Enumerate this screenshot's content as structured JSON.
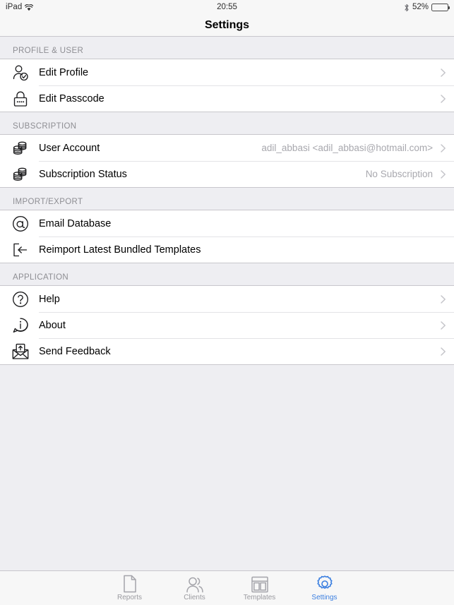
{
  "statusbar": {
    "device": "iPad",
    "wifi_icon": "wifi-icon",
    "time": "20:55",
    "bluetooth_icon": "bluetooth-icon",
    "battery_percent": "52%",
    "battery_level": 52
  },
  "navbar": {
    "title": "Settings"
  },
  "colors": {
    "accent": "#3b7fe0",
    "background": "#eeeef2",
    "row_background": "#ffffff",
    "separator": "#c8c7cc",
    "secondary_text": "#8e8e93",
    "value_text": "#a8a8ae"
  },
  "sections": [
    {
      "header": "PROFILE & USER",
      "rows": [
        {
          "label": "Edit Profile",
          "icon": "user-check-icon",
          "value": "",
          "chevron": true
        },
        {
          "label": "Edit Passcode",
          "icon": "padlock-icon",
          "value": "",
          "chevron": true
        }
      ]
    },
    {
      "header": "SUBSCRIPTION",
      "rows": [
        {
          "label": "User Account",
          "icon": "coin-stack-icon",
          "value": "adil_abbasi <adil_abbasi@hotmail.com>",
          "chevron": true
        },
        {
          "label": "Subscription Status",
          "icon": "coin-stack-icon",
          "value": "No Subscription",
          "chevron": true
        }
      ]
    },
    {
      "header": "IMPORT/EXPORT",
      "rows": [
        {
          "label": "Email Database",
          "icon": "at-sign-icon",
          "value": "",
          "chevron": false
        },
        {
          "label": "Reimport Latest Bundled Templates",
          "icon": "import-arrow-icon",
          "value": "",
          "chevron": false
        }
      ]
    },
    {
      "header": "APPLICATION",
      "rows": [
        {
          "label": "Help",
          "icon": "question-circle-icon",
          "value": "",
          "chevron": true
        },
        {
          "label": "About",
          "icon": "info-bubble-icon",
          "value": "",
          "chevron": true
        },
        {
          "label": "Send Feedback",
          "icon": "envelope-upload-icon",
          "value": "",
          "chevron": true
        }
      ]
    }
  ],
  "tabbar": {
    "tabs": [
      {
        "label": "Reports",
        "icon": "document-icon",
        "active": false
      },
      {
        "label": "Clients",
        "icon": "people-icon",
        "active": false
      },
      {
        "label": "Templates",
        "icon": "layout-grid-icon",
        "active": false
      },
      {
        "label": "Settings",
        "icon": "gear-icon",
        "active": true
      }
    ]
  }
}
